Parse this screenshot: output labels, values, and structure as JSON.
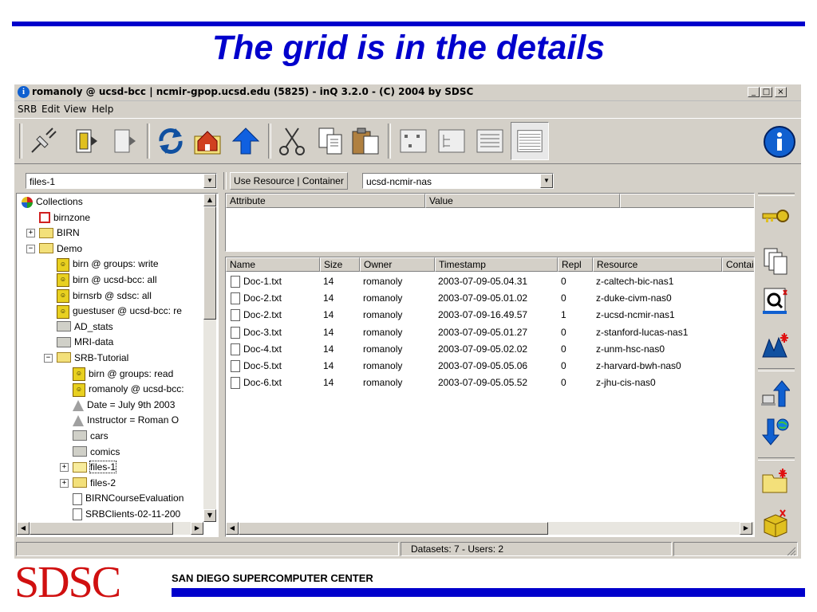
{
  "slide": {
    "title": "The grid is in the details",
    "logo_text": "SDSC",
    "org_name": "SAN DIEGO SUPERCOMPUTER CENTER"
  },
  "window": {
    "title": "romanoly @ ucsd-bcc | ncmir-gpop.ucsd.edu (5825) - inQ 3.2.0 - (C) 2004 by SDSC",
    "controls": {
      "minimize": "_",
      "maximize": "□",
      "close": "×"
    }
  },
  "menu": [
    "SRB",
    "Edit",
    "View",
    "Help"
  ],
  "toolbar_icons": [
    "connect-icon",
    "disconnect-icon",
    "document-icon",
    "refresh-icon",
    "home-icon",
    "up-arrow-icon",
    "cut-icon",
    "copy-icon",
    "paste-icon",
    "small-icons-view-icon",
    "tree-view-icon",
    "list-view-icon",
    "details-view-icon",
    "info-icon"
  ],
  "left_combo": {
    "value": "files-1"
  },
  "resource": {
    "label": "Use Resource | Container",
    "value": "ucsd-ncmir-nas"
  },
  "tree": [
    {
      "label": "Collections",
      "icon": "collections-icon",
      "indent": 0
    },
    {
      "label": "birnzone",
      "icon": "zone-icon",
      "indent": 1
    },
    {
      "label": "BIRN",
      "icon": "folder-icon",
      "indent": 1,
      "toggle": "+"
    },
    {
      "label": "Demo",
      "icon": "folder-icon",
      "indent": 1,
      "toggle": "-"
    },
    {
      "label": "birn @ groups:  write",
      "icon": "user-icon",
      "indent": 2
    },
    {
      "label": "birn @ ucsd-bcc:  all",
      "icon": "user-icon",
      "indent": 2
    },
    {
      "label": "birnsrb @ sdsc:  all",
      "icon": "user-icon",
      "indent": 2
    },
    {
      "label": "guestuser @ ucsd-bcc:  re",
      "icon": "user-icon",
      "indent": 2
    },
    {
      "label": "AD_stats",
      "icon": "grey-folder-icon",
      "indent": 2
    },
    {
      "label": "MRI-data",
      "icon": "grey-folder-icon",
      "indent": 2
    },
    {
      "label": "SRB-Tutorial",
      "icon": "folder-icon",
      "indent": 2,
      "toggle": "-"
    },
    {
      "label": "birn @ groups:  read",
      "icon": "user-icon",
      "indent": 3
    },
    {
      "label": "romanoly @ ucsd-bcc:",
      "icon": "user-icon",
      "indent": 3
    },
    {
      "label": "Date = July 9th 2003",
      "icon": "metadata-icon",
      "indent": 3
    },
    {
      "label": "Instructor = Roman O",
      "icon": "metadata-icon",
      "indent": 3
    },
    {
      "label": "cars",
      "icon": "grey-folder-icon",
      "indent": 3
    },
    {
      "label": "comics",
      "icon": "grey-folder-icon",
      "indent": 3
    },
    {
      "label": "files-1",
      "icon": "open-folder-icon",
      "indent": 3,
      "toggle": "+"
    },
    {
      "label": "files-2",
      "icon": "folder-icon",
      "indent": 3,
      "toggle": "+"
    },
    {
      "label": "BIRNCourseEvaluation",
      "icon": "file-icon",
      "indent": 3
    },
    {
      "label": "SRBClients-02-11-200",
      "icon": "file-icon",
      "indent": 3
    }
  ],
  "metadata_table": {
    "headers": [
      "Attribute",
      "Value"
    ]
  },
  "file_table": {
    "headers": [
      "Name",
      "Size",
      "Owner",
      "Timestamp",
      "Repl",
      "Resource",
      "Contai"
    ],
    "rows": [
      [
        "Doc-1.txt",
        "14",
        "romanoly",
        "2003-07-09-05.04.31",
        "0",
        "z-caltech-bic-nas1"
      ],
      [
        "Doc-2.txt",
        "14",
        "romanoly",
        "2003-07-09-05.01.02",
        "0",
        "z-duke-civm-nas0"
      ],
      [
        "Doc-2.txt",
        "14",
        "romanoly",
        "2003-07-09-16.49.57",
        "1",
        "z-ucsd-ncmir-nas1"
      ],
      [
        "Doc-3.txt",
        "14",
        "romanoly",
        "2003-07-09-05.01.27",
        "0",
        "z-stanford-lucas-nas1"
      ],
      [
        "Doc-4.txt",
        "14",
        "romanoly",
        "2003-07-09-05.02.02",
        "0",
        "z-unm-hsc-nas0"
      ],
      [
        "Doc-5.txt",
        "14",
        "romanoly",
        "2003-07-09-05.05.06",
        "0",
        "z-harvard-bwh-nas0"
      ],
      [
        "Doc-6.txt",
        "14",
        "romanoly",
        "2003-07-09-05.05.52",
        "0",
        "z-jhu-cis-nas0"
      ]
    ]
  },
  "sidebar_icons": [
    "key-icon",
    "copy-files-icon",
    "query-icon",
    "metadata-extract-icon",
    "upload-icon",
    "download-icon",
    "new-folder-icon",
    "new-container-icon"
  ],
  "status": {
    "text": "Datasets: 7 - Users: 2"
  }
}
